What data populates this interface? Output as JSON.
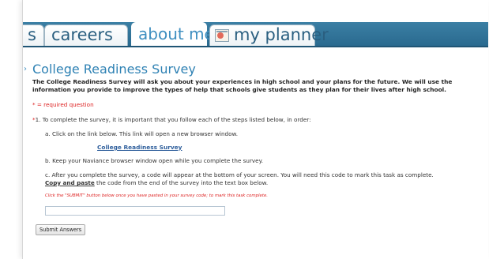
{
  "tabs": [
    {
      "label": "s",
      "active": false
    },
    {
      "label": "careers",
      "active": false
    },
    {
      "label": "about me",
      "active": true
    },
    {
      "label": "my planner",
      "active": false,
      "icon": "planner-icon"
    }
  ],
  "page": {
    "marker": "›",
    "title": "College Readiness Survey",
    "intro": "The College Readiness Survey will ask you about your experiences in high school and your plans for the future. We will use the information you provide to improve the types of help that schools give students as they plan for their lives after high school."
  },
  "required_note": {
    "star": "*",
    "text": " = required question"
  },
  "question": {
    "star": "*",
    "text": "1. To complete the survey, it is important that you follow each of the steps listed below, in order:"
  },
  "steps": {
    "a": "a. Click on the link below. This link will open a new browser window.",
    "link": "College Readiness Survey",
    "b": "b. Keep your Naviance browser window open while you complete the survey.",
    "c_part1": "c. After you complete the survey, a code will appear at the bottom of your screen.  You will need this code to mark this task as complete.",
    "c_bold": "Copy and paste",
    "c_part2": " the code from the end of the survey into the text box below."
  },
  "submit_note": "Click the \"SUBMIT\" button below once you have pasted in your survey code; to mark this task complete.",
  "code_input": {
    "value": "",
    "placeholder": ""
  },
  "submit_button": "Submit Answers",
  "colors": {
    "tabbar": "#2a6a8f",
    "title": "#2f82b4",
    "required": "#dd2222",
    "link": "#2f5f9c"
  }
}
